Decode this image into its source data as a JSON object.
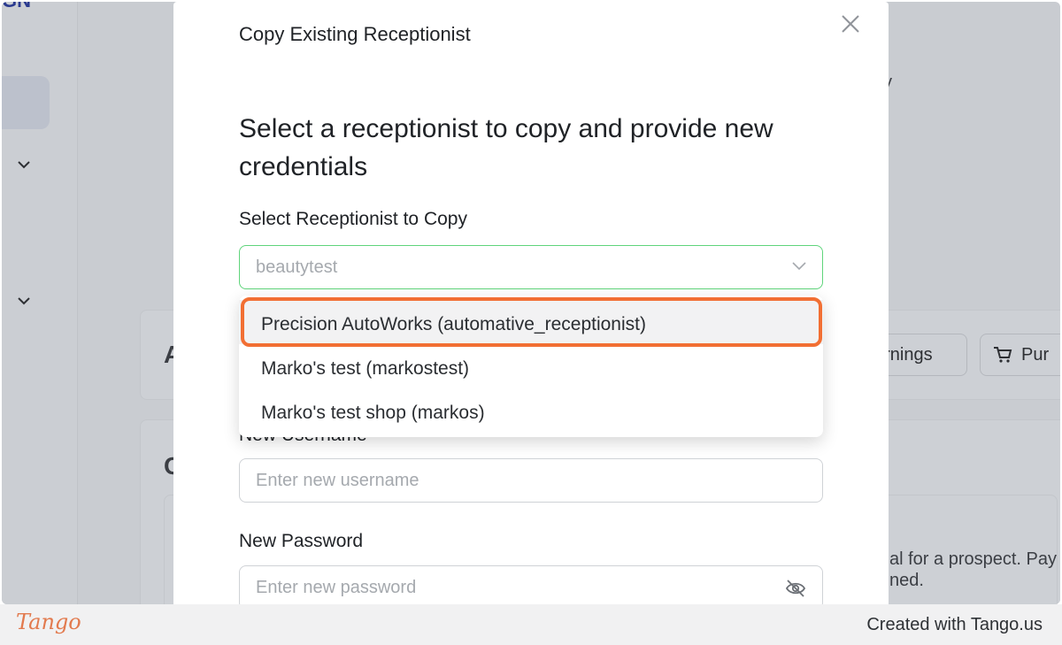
{
  "background": {
    "logo_fragment": "GN",
    "partial_text_top_right": "y",
    "card_heading_a": "A",
    "card_heading_b": "C",
    "earnings_button": "arnings",
    "purchase_button": "Pur",
    "description_line1": "al for a prospect. Pay",
    "description_line2": "ned."
  },
  "modal": {
    "title": "Copy Existing Receptionist",
    "heading": "Select a receptionist to copy and provide new credentials",
    "select_label": "Select Receptionist to Copy",
    "select_value": "beautytest",
    "username_label": "New Username",
    "username_placeholder": "Enter new username",
    "password_label": "New Password",
    "password_placeholder": "Enter new password"
  },
  "dropdown": {
    "options": [
      {
        "label": "Precision AutoWorks (automative_receptionist)",
        "highlighted": true
      },
      {
        "label": "Marko's test (markostest)",
        "highlighted": false
      },
      {
        "label": "Marko's test shop (markos)",
        "highlighted": false
      }
    ]
  },
  "footer": {
    "logo": "Tango",
    "credit": "Created with Tango.us"
  },
  "colors": {
    "highlight": "#f26f33",
    "select_border": "#5fd47b",
    "tango_brand": "#e27a4e"
  }
}
